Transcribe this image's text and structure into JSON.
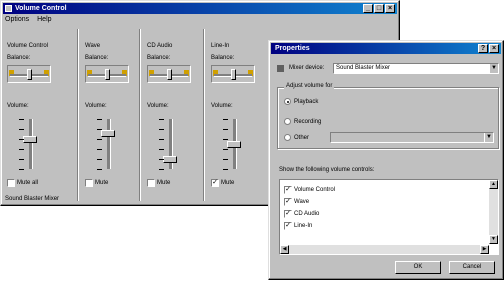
{
  "volume_control": {
    "title": "Volume Control",
    "menu": [
      "Options",
      "Help"
    ],
    "columns": [
      {
        "name": "Volume Control",
        "balance_label": "Balance:",
        "volume_label": "Volume:",
        "mute_label": "Mute all",
        "mute_checked": false,
        "level": 0.6
      },
      {
        "name": "Wave",
        "balance_label": "Balance:",
        "volume_label": "Volume:",
        "mute_label": "Mute",
        "mute_checked": false,
        "level": 0.75
      },
      {
        "name": "CD Audio",
        "balance_label": "Balance:",
        "volume_label": "Volume:",
        "mute_label": "Mute",
        "mute_checked": false,
        "level": 0.15
      },
      {
        "name": "Line-In",
        "balance_label": "Balance:",
        "volume_label": "Volume:",
        "mute_label": "Mute",
        "mute_checked": true,
        "level": 0.5
      }
    ],
    "status": "Sound Blaster Mixer"
  },
  "properties": {
    "title": "Properties",
    "mixer_label": "Mixer device:",
    "mixer_value": "Sound Blaster Mixer",
    "adjust_group": "Adjust volume for",
    "radio_playback": "Playback",
    "radio_recording": "Recording",
    "radio_other": "Other",
    "show_label": "Show the following volume controls:",
    "controls": [
      {
        "label": "Volume Control",
        "checked": true
      },
      {
        "label": "Wave",
        "checked": true
      },
      {
        "label": "CD Audio",
        "checked": true
      },
      {
        "label": "Line-In",
        "checked": true
      }
    ],
    "ok_label": "OK",
    "cancel_label": "Cancel"
  }
}
